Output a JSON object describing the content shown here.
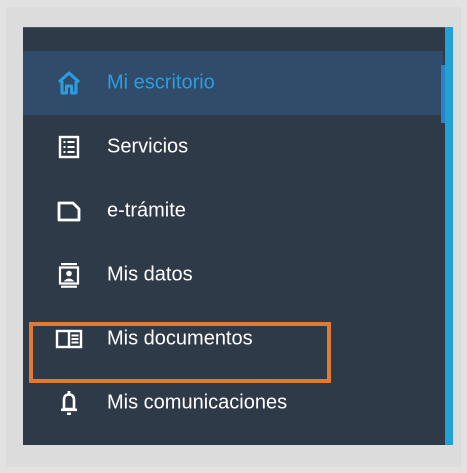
{
  "sidebar": {
    "items": [
      {
        "label": "Mi escritorio",
        "icon": "home-icon",
        "active": true
      },
      {
        "label": "Servicios",
        "icon": "list-icon",
        "active": false
      },
      {
        "label": "e-trámite",
        "icon": "document-icon",
        "active": false
      },
      {
        "label": "Mis datos",
        "icon": "id-card-icon",
        "active": false
      },
      {
        "label": "Mis documentos",
        "icon": "book-icon",
        "active": false
      },
      {
        "label": "Mis comunicaciones",
        "icon": "bell-icon",
        "active": false
      }
    ]
  },
  "colors": {
    "sidebar_background": "#2f3a48",
    "active_background": "#304c6a",
    "active_text": "#2b9de0",
    "text": "#ffffff",
    "scrollbar": "#22a1d7",
    "highlight_border": "#e27a33"
  }
}
